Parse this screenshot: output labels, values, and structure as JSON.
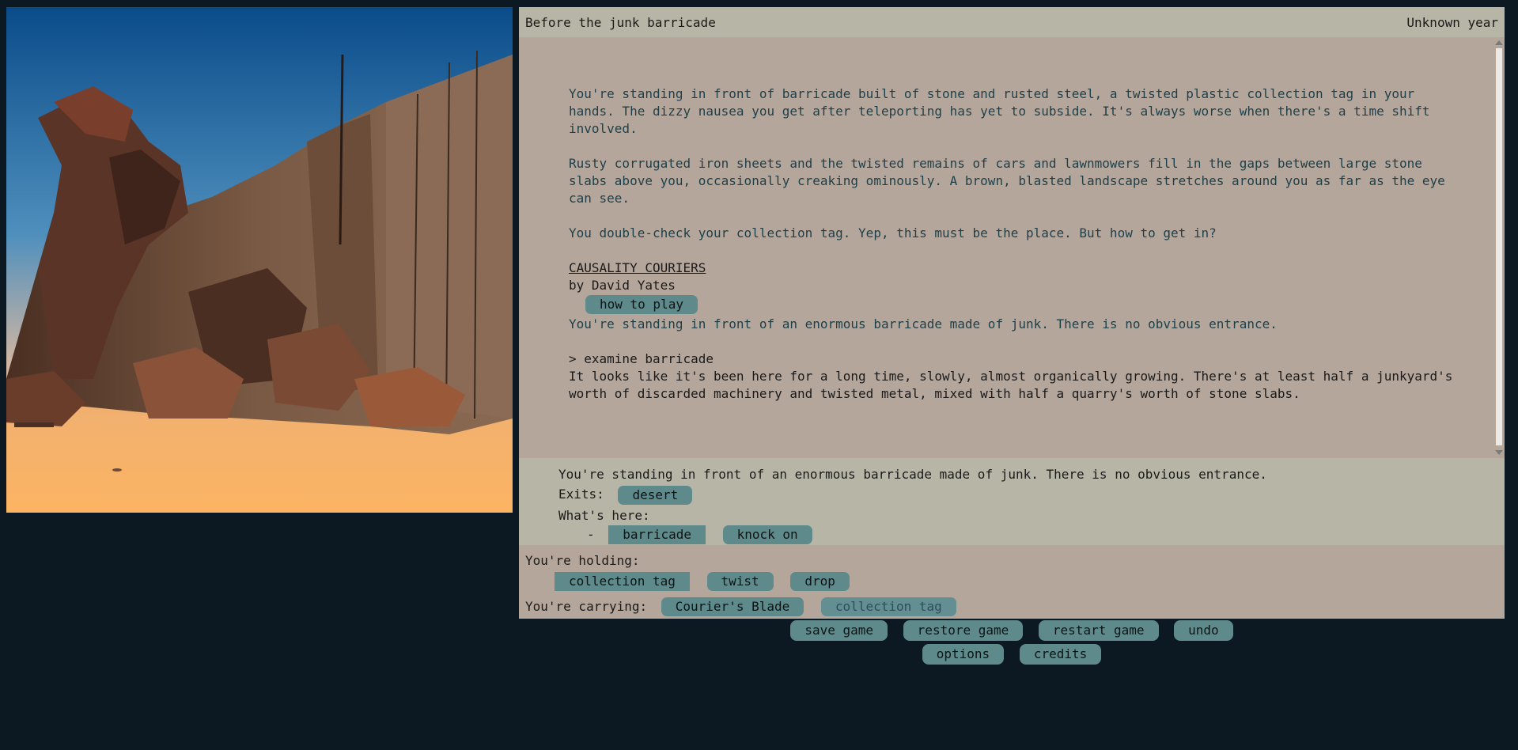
{
  "status": {
    "location": "Before the junk barricade",
    "time": "Unknown year"
  },
  "transcript": {
    "intro_1": "You're standing in front of barricade built of stone and rusted steel, a twisted plastic collection tag in your hands. The dizzy nausea you get after teleporting has yet to subside. It's always worse when there's a time shift involved.",
    "intro_2": "Rusty corrugated iron sheets and the twisted remains of cars and lawnmowers fill in the gaps between large stone slabs above you, occasionally creaking ominously. A brown, blasted landscape stretches around you as far as the eye can see.",
    "intro_3": "You double-check your collection tag. Yep, this must be the place. But how to get in?",
    "game_title": "CAUSALITY COURIERS",
    "byline": "by David Yates",
    "how_to_play": "how to play",
    "room_desc": "You're standing in front of an enormous barricade made of junk. There is no obvious entrance.",
    "command": "> examine barricade",
    "response": "It looks like it's been here for a long time, slowly, almost organically growing. There's at least half a junkyard's worth of discarded machinery and twisted metal, mixed with half a quarry's worth of stone slabs."
  },
  "room": {
    "description": "You're standing in front of an enormous barricade made of junk. There is no obvious entrance.",
    "exits_label": "Exits:",
    "exits": [
      "desert"
    ],
    "here_label": "What's here:",
    "bullet": "-",
    "item": "barricade",
    "item_action": "knock on"
  },
  "inventory": {
    "holding_label": "You're holding:",
    "held_item": "collection tag",
    "held_actions": [
      "twist",
      "drop"
    ],
    "carrying_label": "You're carrying:",
    "carried_items": [
      "Courier's Blade",
      "collection tag"
    ]
  },
  "controls": {
    "row1": [
      "save game",
      "restore game",
      "restart game",
      "undo"
    ],
    "row2": [
      "options",
      "credits"
    ]
  },
  "colors": {
    "page_bg": "#0c1822",
    "panel_bg": "#b5a69c",
    "bar_bg": "#b7b6a6",
    "button_bg": "#5e8a8c",
    "narration_text": "#1e3f48"
  }
}
